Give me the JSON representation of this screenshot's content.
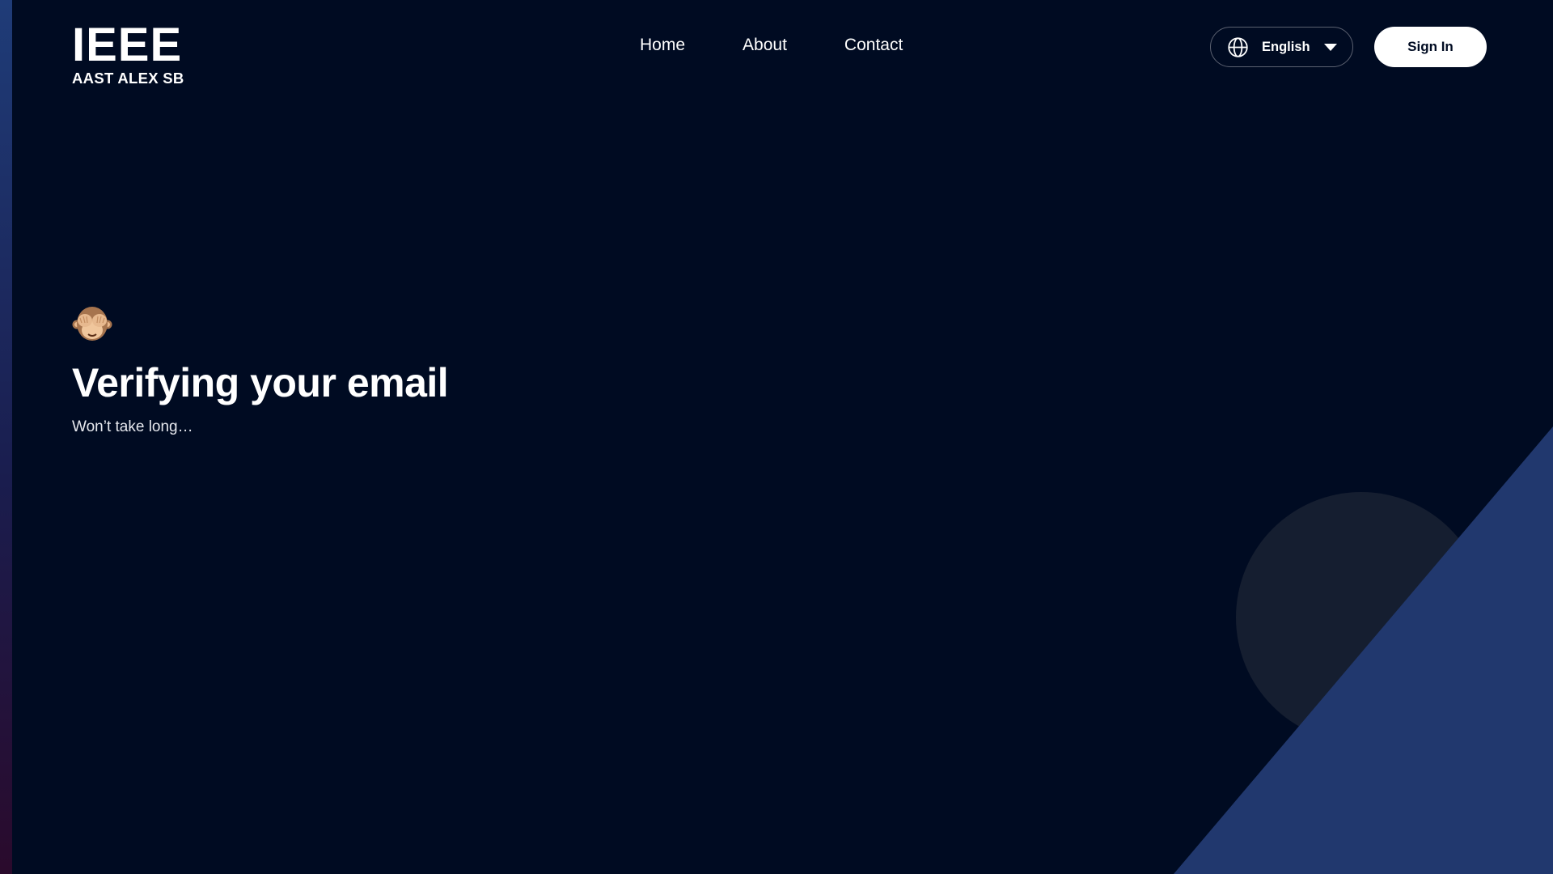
{
  "logo": {
    "main": "IEEE",
    "sub": "AAST ALEX SB"
  },
  "nav": {
    "items": [
      {
        "label": "Home"
      },
      {
        "label": "About"
      },
      {
        "label": "Contact"
      }
    ]
  },
  "language": {
    "selected": "English",
    "icon": "globe-icon"
  },
  "auth": {
    "sign_in_label": "Sign In"
  },
  "hero": {
    "emoji_icon": "see-no-evil-monkey-icon",
    "title": "Verifying your email",
    "subtitle": "Won’t take long…"
  },
  "colors": {
    "background": "#000b22",
    "accent_shape": "#21386e",
    "circle": "#151e30",
    "button_bg": "#ffffff"
  }
}
